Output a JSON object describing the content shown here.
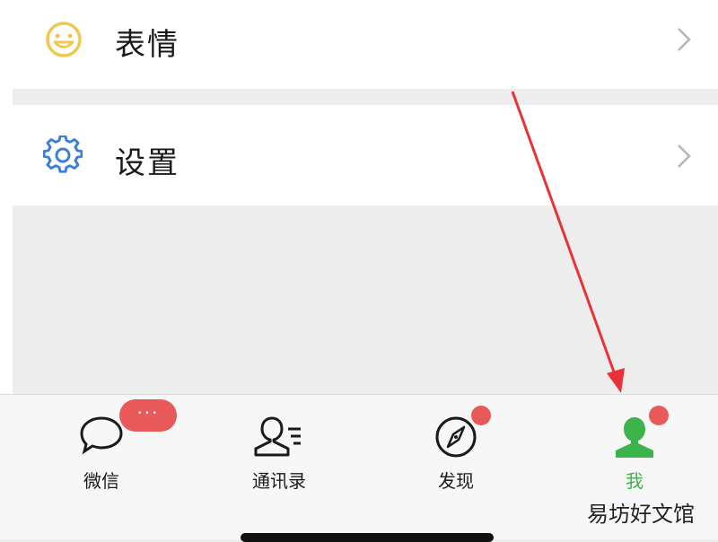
{
  "settings_list": {
    "emoji_label": "表情",
    "settings_label": "设置"
  },
  "tab_bar": {
    "tabs": [
      {
        "label": "微信",
        "icon": "chat-bubble-icon",
        "badge": "···"
      },
      {
        "label": "通讯录",
        "icon": "contacts-icon"
      },
      {
        "label": "发现",
        "icon": "compass-icon"
      },
      {
        "label": "我",
        "icon": "person-icon",
        "active": true
      }
    ]
  },
  "watermark": "易坊好文馆",
  "colors": {
    "accent": "#3cb44b",
    "badge": "#e85a5a",
    "arrow": "#e8323a",
    "emoji_icon": "#f0c850",
    "settings_icon": "#3d7fd6"
  }
}
